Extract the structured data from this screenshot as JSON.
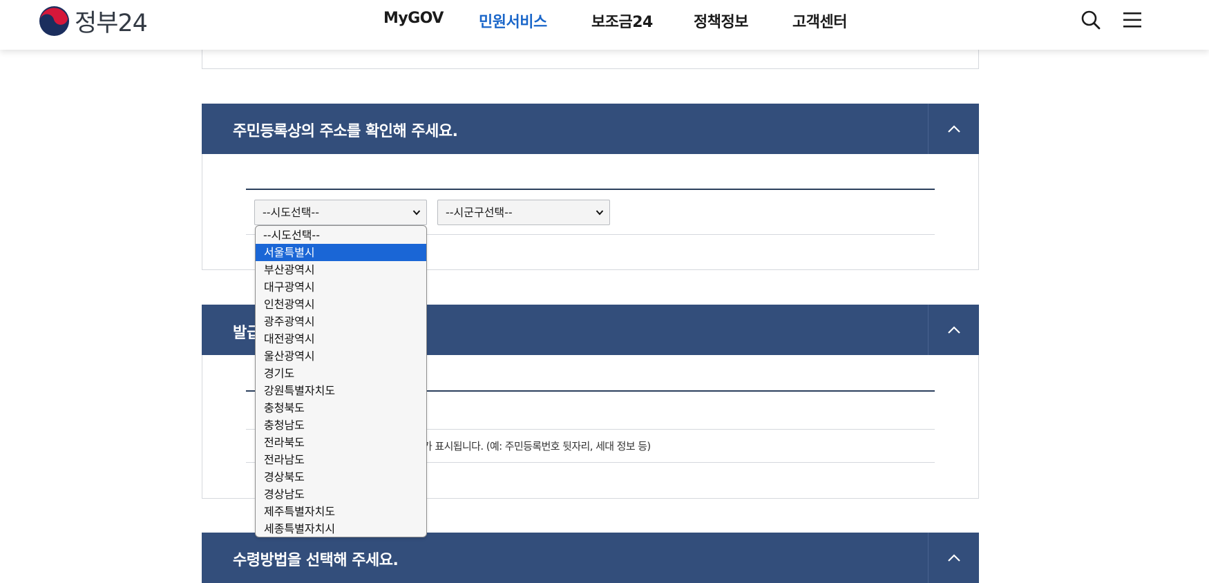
{
  "header": {
    "logo_text": "정부24",
    "nav": [
      "MyGOV",
      "민원서비스",
      "보조금24",
      "정책정보",
      "고객센터"
    ],
    "active_nav": "민원서비스",
    "search_icon": "search-icon",
    "menu_icon": "hamburger-menu-icon"
  },
  "address_panel": {
    "title": "주민등록상의 주소를 확인해 주세요.",
    "toggle_icon": "chevron-up-icon",
    "sido_select": {
      "value": "--시도선택--"
    },
    "sigungu_select": {
      "value": "--시군구선택--"
    }
  },
  "sido_dropdown": {
    "options": [
      "--시도선택--",
      "서울특별시",
      "부산광역시",
      "대구광역시",
      "인천광역시",
      "광주광역시",
      "대전광역시",
      "울산광역시",
      "경기도",
      "강원특별자치도",
      "충청북도",
      "충청남도",
      "전라북도",
      "전라남도",
      "경상북도",
      "경상남도",
      "제주특별자치도",
      "세종특별자치시"
    ],
    "highlighted": "서울특별시"
  },
  "issue_panel": {
    "title_visible": "발급",
    "toggle_icon": "chevron-up-icon",
    "info_text": "가 표시됩니다. (예: 주민등록번호 뒷자리, 세대 정보 등)"
  },
  "receive_panel": {
    "title": "수령방법을 선택해 주세요.",
    "toggle_icon": "chevron-up-icon"
  },
  "colors": {
    "panel_header": "#334e7b",
    "active_nav": "#1a66c9",
    "selected_option": "#1a66d6"
  }
}
